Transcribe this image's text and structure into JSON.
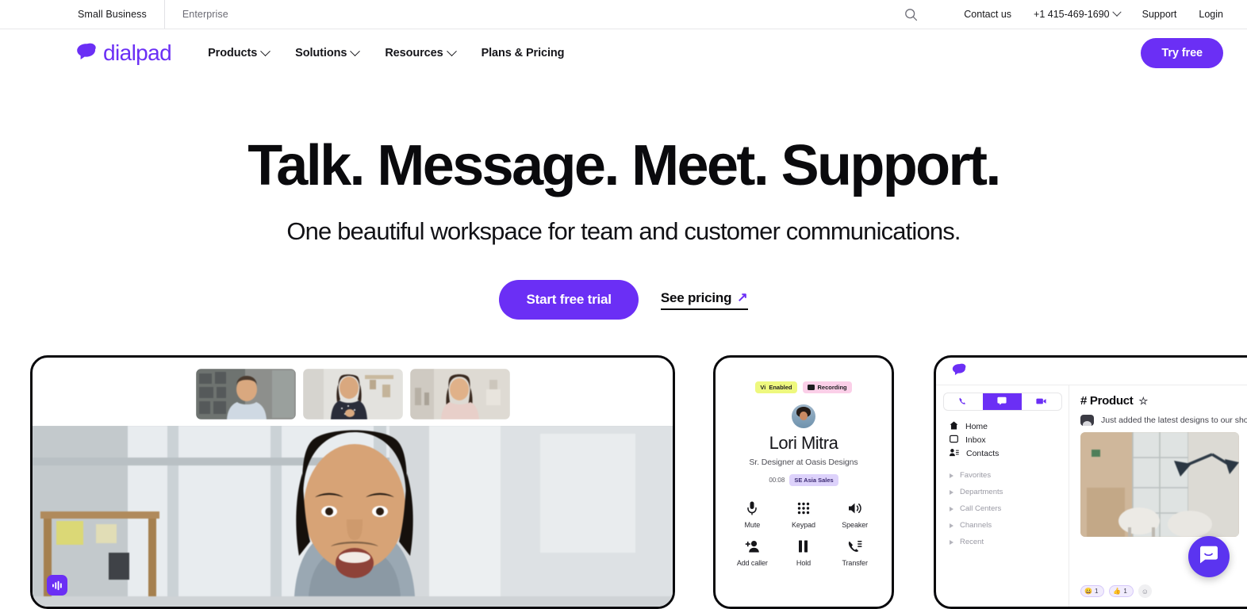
{
  "utility_bar": {
    "segments": [
      {
        "label": "Small Business",
        "active": true
      },
      {
        "label": "Enterprise",
        "active": false
      }
    ],
    "search_icon": "search-icon",
    "links": [
      {
        "label": "Contact us",
        "has_chevron": false
      },
      {
        "label": "+1 415-469-1690",
        "has_chevron": true
      },
      {
        "label": "Support",
        "has_chevron": false
      },
      {
        "label": "Login",
        "has_chevron": false
      }
    ]
  },
  "main_nav": {
    "logo_text": "dialpad",
    "logo_icon": "dialpad-logo-icon",
    "items": [
      {
        "label": "Products",
        "has_chevron": true
      },
      {
        "label": "Solutions",
        "has_chevron": true
      },
      {
        "label": "Resources",
        "has_chevron": true
      },
      {
        "label": "Plans & Pricing",
        "has_chevron": false
      }
    ],
    "cta_label": "Try free"
  },
  "hero": {
    "headline": "Talk. Message. Meet. Support.",
    "subhead": "One beautiful workspace for team and customer communications.",
    "primary_cta": "Start free trial",
    "secondary_cta": "See pricing",
    "secondary_cta_icon": "arrow-up-right-icon"
  },
  "cards": {
    "meeting": {
      "name": "video-meeting-card",
      "thumbnails": [
        {
          "alt": "participant-bookshelf-man"
        },
        {
          "alt": "participant-woman-shelf"
        },
        {
          "alt": "participant-woman-kitchen"
        }
      ],
      "stage_alt": "active-speaker-video",
      "badge_icon": "voice-intelligence-icon"
    },
    "call": {
      "name": "active-call-card",
      "badges": [
        {
          "label": "Enabled",
          "prefix": "Vi",
          "type": "vi"
        },
        {
          "label": "Recording",
          "prefix": "",
          "type": "recording"
        }
      ],
      "contact_name": "Lori Mitra",
      "contact_role": "Sr. Designer at Oasis Designs",
      "timer": "00:08",
      "line_tag": "SE Asia Sales",
      "controls": [
        {
          "label": "Mute",
          "icon": "microphone-icon"
        },
        {
          "label": "Keypad",
          "icon": "keypad-icon"
        },
        {
          "label": "Speaker",
          "icon": "speaker-icon"
        },
        {
          "label": "Add caller",
          "icon": "add-person-icon"
        },
        {
          "label": "Hold",
          "icon": "pause-icon"
        },
        {
          "label": "Transfer",
          "icon": "transfer-call-icon"
        }
      ]
    },
    "messaging": {
      "name": "messaging-app-card",
      "logo_icon": "dialpad-mark-icon",
      "tabs": [
        {
          "icon": "phone-icon",
          "selected": false
        },
        {
          "icon": "chat-icon",
          "selected": true
        },
        {
          "icon": "video-icon",
          "selected": false
        }
      ],
      "nav_items": [
        {
          "label": "Home",
          "icon": "home-icon"
        },
        {
          "label": "Inbox",
          "icon": "inbox-icon"
        },
        {
          "label": "Contacts",
          "icon": "contacts-icon"
        }
      ],
      "groups": [
        {
          "label": "Favorites"
        },
        {
          "label": "Departments"
        },
        {
          "label": "Call Centers"
        },
        {
          "label": "Channels"
        },
        {
          "label": "Recent"
        }
      ],
      "channel_title": "# Product",
      "channel_star_icon": "star-icon",
      "message_text": "Just added the latest designs to our sho",
      "message_photo_alt": "office-interior-lamp-photo",
      "reactions": [
        {
          "emoji": "😀",
          "count": "1"
        },
        {
          "emoji": "👍",
          "count": "1"
        }
      ],
      "reaction_add_icon": "add-reaction-icon"
    }
  },
  "chat_widget": {
    "icon": "chat-bubble-icon",
    "label": "Open chat"
  },
  "colors": {
    "brand_purple": "#6b2ff5",
    "chat_purple": "#5b34f0",
    "badge_vi": "#eef87e",
    "badge_recording": "#fbcfe8",
    "tag_purple_bg": "#ddd2fb",
    "text_dark": "#0a0a0d"
  }
}
